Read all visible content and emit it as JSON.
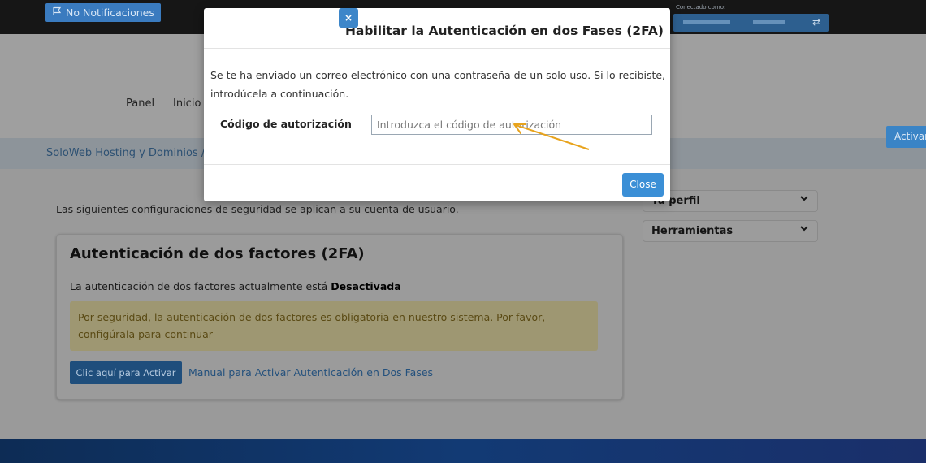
{
  "topbar": {
    "notifications_label": "No Notificaciones",
    "connected_as": "Conectado como:"
  },
  "nav": {
    "items": [
      "Panel",
      "Inicio"
    ]
  },
  "breadcrumb": {
    "text": "SoloWeb Hosting y Dominios /"
  },
  "side_tab": {
    "label": "Activar"
  },
  "main": {
    "intro": "Las siguientes configuraciones de seguridad se aplican a su cuenta de usuario.",
    "card": {
      "title": "Autenticación de dos factores (2FA)",
      "status_prefix": "La autenticación de dos factores actualmente está ",
      "status_value": "Desactivada",
      "warning": "Por seguridad, la autenticación de dos factores es obligatoria en nuestro sistema. Por favor, configúrala para continuar",
      "activate_button": "Clic aquí para Activar",
      "manual_link": "Manual para Activar Autenticación en Dos Fases"
    }
  },
  "sidebar": {
    "profile_label": "Tu perfil",
    "tools_label": "Herramientas"
  },
  "modal": {
    "title": "Habilitar la Autenticación en dos Fases (2FA)",
    "close_symbol": "×",
    "body": "Se te ha enviado un correo electrónico con una contraseña de un solo uso. Si lo recibiste, introdúcela a continuación.",
    "code_label": "Código de autorización",
    "code_placeholder": "Introduzca el código de autorización",
    "close_button": "Close"
  },
  "colors": {
    "accent": "#3b8fd6",
    "annotation_arrow": "#e8a31c"
  }
}
